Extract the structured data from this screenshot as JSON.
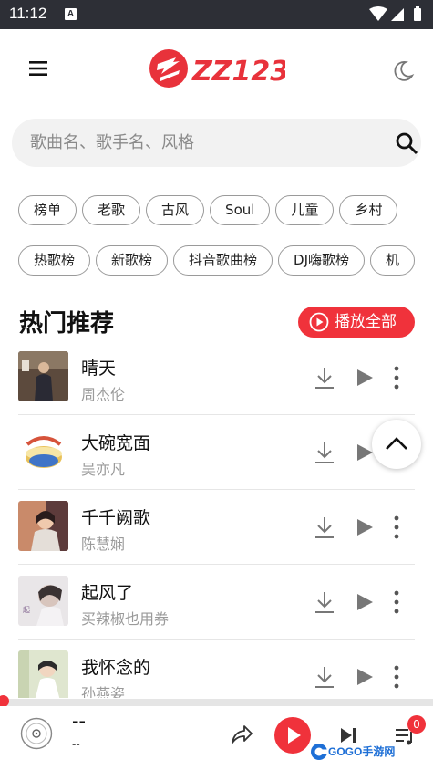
{
  "status_bar": {
    "time": "11:12",
    "app_icon_letter": "A"
  },
  "header": {
    "logo_text": "ZZ123",
    "brand_color": "#e8323b"
  },
  "search": {
    "placeholder": "歌曲名、歌手名、风格"
  },
  "tags_row1": [
    "榜单",
    "老歌",
    "古风",
    "Soul",
    "儿童",
    "乡村"
  ],
  "tags_row2": [
    "热歌榜",
    "新歌榜",
    "抖音歌曲榜",
    "DJ嗨歌榜",
    "机"
  ],
  "section": {
    "title": "热门推荐",
    "play_all_label": "播放全部"
  },
  "songs": [
    {
      "title": "晴天",
      "artist": "周杰伦"
    },
    {
      "title": "大碗宽面",
      "artist": "吴亦凡"
    },
    {
      "title": "千千阙歌",
      "artist": "陈慧娴"
    },
    {
      "title": "起风了",
      "artist": "买辣椒也用券"
    },
    {
      "title": "我怀念的",
      "artist": "孙燕姿"
    }
  ],
  "player": {
    "title": "--",
    "artist": "--",
    "queue_count": "0",
    "progress": 0
  },
  "watermark": {
    "text": "GOGO手游网"
  },
  "colors": {
    "accent": "#f0323b",
    "status_bar": "#2d2f36"
  }
}
